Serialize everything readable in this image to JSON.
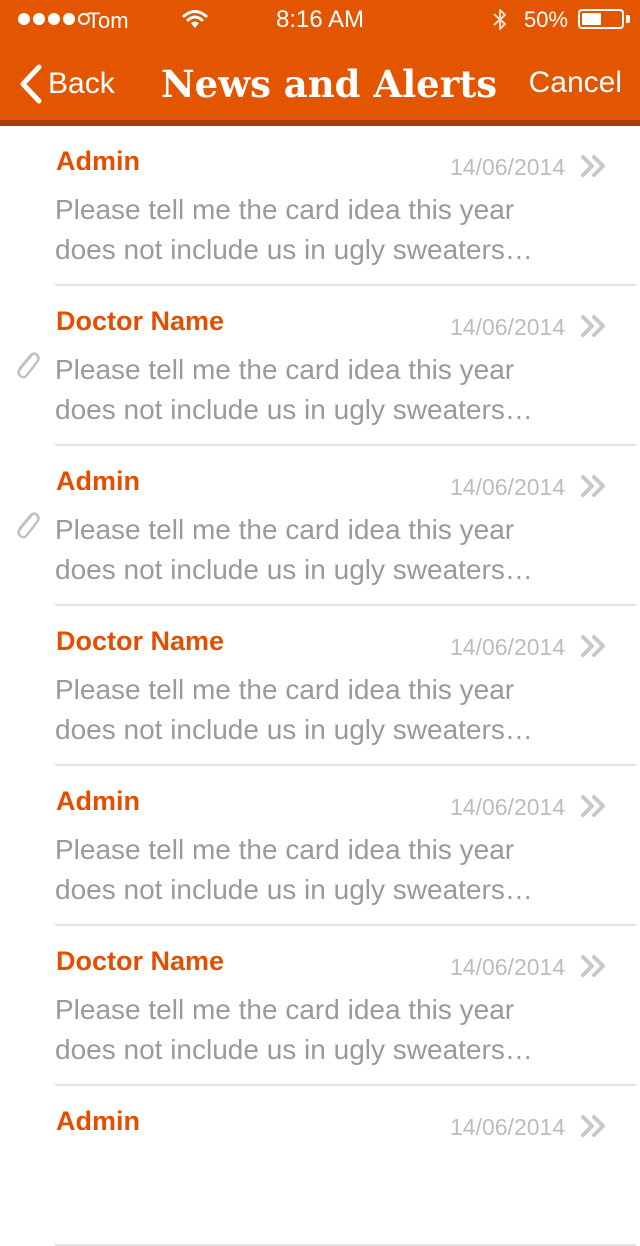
{
  "status_bar": {
    "carrier": "Tom",
    "time": "8:16 AM",
    "battery": "50%",
    "battery_level": 0.5
  },
  "nav": {
    "back_label": "Back",
    "title": "News and Alerts",
    "cancel_label": "Cancel"
  },
  "colors": {
    "accent": "#e45500",
    "sender_text": "#e15000",
    "preview_text": "#9a9a9a",
    "date_text": "#bdbdbd"
  },
  "messages": [
    {
      "sender": "Admin",
      "date": "14/06/2014",
      "line1": "Please tell me the card idea this year",
      "line2": "does not include us in ugly sweaters…",
      "attachment": false
    },
    {
      "sender": "Doctor Name",
      "date": "14/06/2014",
      "line1": "Please tell me the card idea this year",
      "line2": "does not include us in ugly sweaters…",
      "attachment": true
    },
    {
      "sender": "Admin",
      "date": "14/06/2014",
      "line1": "Please tell me the card idea this year",
      "line2": "does not include us in ugly sweaters…",
      "attachment": true
    },
    {
      "sender": "Doctor Name",
      "date": "14/06/2014",
      "line1": "Please tell me the card idea this year",
      "line2": "does not include us in ugly sweaters…",
      "attachment": false
    },
    {
      "sender": "Admin",
      "date": "14/06/2014",
      "line1": "Please tell me the card idea this year",
      "line2": "does not include us in ugly sweaters…",
      "attachment": false
    },
    {
      "sender": "Doctor Name",
      "date": "14/06/2014",
      "line1": "Please tell me the card idea this year",
      "line2": "does not include us in ugly sweaters…",
      "attachment": false
    },
    {
      "sender": "Admin",
      "date": "14/06/2014",
      "line1": "",
      "line2": "",
      "attachment": false
    }
  ]
}
